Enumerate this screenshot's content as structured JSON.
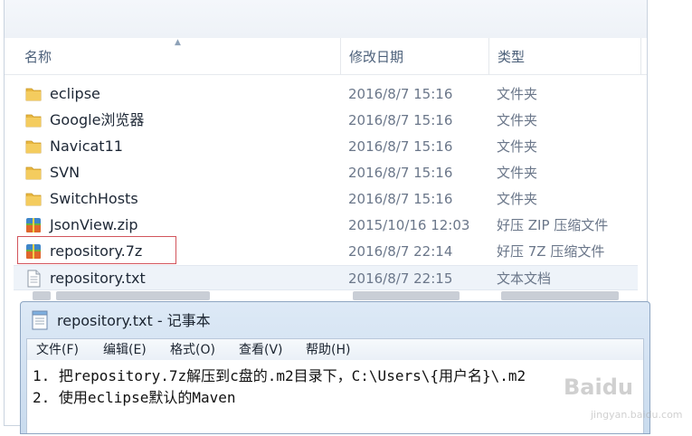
{
  "explorer": {
    "columns": {
      "name": "名称",
      "date": "修改日期",
      "type": "类型"
    },
    "files": [
      {
        "name": "eclipse",
        "date": "2016/8/7 15:16",
        "type": "文件夹",
        "icon": "folder-icon"
      },
      {
        "name": "Google浏览器",
        "date": "2016/8/7 15:16",
        "type": "文件夹",
        "icon": "folder-icon"
      },
      {
        "name": "Navicat11",
        "date": "2016/8/7 15:16",
        "type": "文件夹",
        "icon": "folder-icon"
      },
      {
        "name": "SVN",
        "date": "2016/8/7 15:16",
        "type": "文件夹",
        "icon": "folder-icon"
      },
      {
        "name": "SwitchHosts",
        "date": "2016/8/7 15:16",
        "type": "文件夹",
        "icon": "folder-icon"
      },
      {
        "name": "JsonView.zip",
        "date": "2015/10/16 12:03",
        "type": "好压 ZIP 压缩文件",
        "icon": "archive-icon"
      },
      {
        "name": "repository.7z",
        "date": "2016/8/7 22:14",
        "type": "好压 7Z 压缩文件",
        "icon": "archive-icon"
      },
      {
        "name": "repository.txt",
        "date": "2016/8/7 22:15",
        "type": "文本文档",
        "icon": "text-file-icon"
      }
    ]
  },
  "notepad": {
    "title": "repository.txt - 记事本",
    "menu": [
      "文件(F)",
      "编辑(E)",
      "格式(O)",
      "查看(V)",
      "帮助(H)"
    ],
    "lines": [
      "1. 把repository.7z解压到c盘的.m2目录下，C:\\Users\\{用户名}\\.m2",
      "2. 使用eclipse默认的Maven"
    ]
  },
  "watermark": {
    "brand": "Baidu",
    "site": "jingyan.baidu.com"
  },
  "colors": {
    "highlight": "#d2545c",
    "folder": "#e8b740",
    "header_text": "#4c607a"
  }
}
